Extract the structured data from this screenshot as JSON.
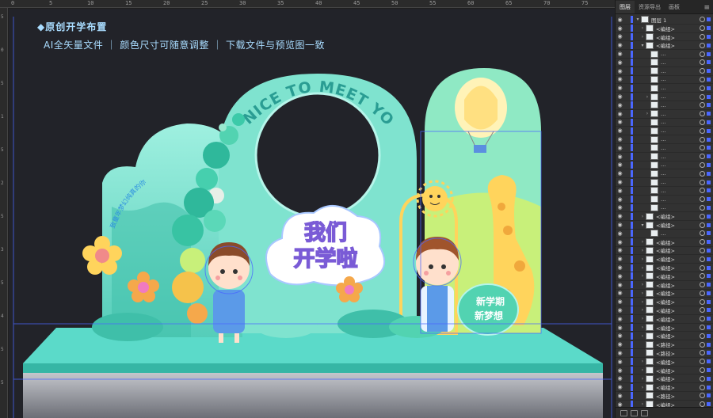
{
  "ruler": {
    "top_numbers": [
      "0",
      "5",
      "10",
      "15",
      "20",
      "25",
      "30",
      "35",
      "40",
      "45",
      "50",
      "55",
      "60",
      "65",
      "70",
      "75"
    ],
    "left_numbers": [
      "5",
      "0",
      "5",
      "1",
      "5",
      "2",
      "5",
      "3",
      "5",
      "4",
      "5",
      "5"
    ]
  },
  "canvas": {
    "heading_title": "◆原创开学布置",
    "heading_subtitle": "AI全矢量文件 ｜ 颜色尺寸可随意调整 ｜ 下载文件与预览图一致"
  },
  "artwork": {
    "arch_text": "NICE TO MEET YOU",
    "left_curve_text": "致童年梦幻纯真的你",
    "title_line1": "我们",
    "title_line2": "开学啦",
    "bubble_line1": "新学期",
    "bubble_line2": "新梦想",
    "colors": {
      "mint": "#7fe3cf",
      "teal": "#2fb3a2",
      "light_green": "#c8f07a",
      "yellow": "#ffd45c",
      "pink": "#f07ac0",
      "purple": "#7a5bd6",
      "blue_selection": "#4a67ff",
      "stage_top": "#59d9c8",
      "stage_front": "#9ea0a8"
    }
  },
  "panel": {
    "tabs": [
      "图层",
      "资源导出",
      "画板"
    ],
    "active_tab": "图层",
    "menu_icon": "hamburger-icon",
    "layers": [
      {
        "name": "图层 1",
        "indent": 0,
        "arrow": "▾"
      },
      {
        "name": "<编组>",
        "indent": 1,
        "arrow": "›"
      },
      {
        "name": "<编组>",
        "indent": 1,
        "arrow": "›"
      },
      {
        "name": "<编组>",
        "indent": 1,
        "arrow": "▾"
      },
      {
        "name": "…",
        "indent": 2,
        "arrow": ""
      },
      {
        "name": "…",
        "indent": 2,
        "arrow": ""
      },
      {
        "name": "…",
        "indent": 2,
        "arrow": ""
      },
      {
        "name": "…",
        "indent": 2,
        "arrow": ""
      },
      {
        "name": "…",
        "indent": 2,
        "arrow": ""
      },
      {
        "name": "…",
        "indent": 2,
        "arrow": "›"
      },
      {
        "name": "…",
        "indent": 2,
        "arrow": ""
      },
      {
        "name": "…",
        "indent": 2,
        "arrow": "›"
      },
      {
        "name": "…",
        "indent": 2,
        "arrow": ""
      },
      {
        "name": "…",
        "indent": 2,
        "arrow": ""
      },
      {
        "name": "…",
        "indent": 2,
        "arrow": ""
      },
      {
        "name": "…",
        "indent": 2,
        "arrow": ""
      },
      {
        "name": "…",
        "indent": 2,
        "arrow": ""
      },
      {
        "name": "…",
        "indent": 2,
        "arrow": ""
      },
      {
        "name": "…",
        "indent": 2,
        "arrow": ""
      },
      {
        "name": "…",
        "indent": 2,
        "arrow": ""
      },
      {
        "name": "…",
        "indent": 2,
        "arrow": ""
      },
      {
        "name": "…",
        "indent": 2,
        "arrow": ""
      },
      {
        "name": "…",
        "indent": 2,
        "arrow": ""
      },
      {
        "name": "<编组>",
        "indent": 1,
        "arrow": "›"
      },
      {
        "name": "<编组>",
        "indent": 1,
        "arrow": "▾"
      },
      {
        "name": "…",
        "indent": 2,
        "arrow": ""
      },
      {
        "name": "<编组>",
        "indent": 1,
        "arrow": "›"
      },
      {
        "name": "<编组>",
        "indent": 1,
        "arrow": "›"
      },
      {
        "name": "<编组>",
        "indent": 1,
        "arrow": "›"
      },
      {
        "name": "<编组>",
        "indent": 1,
        "arrow": "›"
      },
      {
        "name": "<编组>",
        "indent": 1,
        "arrow": "›"
      },
      {
        "name": "<编组>",
        "indent": 1,
        "arrow": "›"
      },
      {
        "name": "<编组>",
        "indent": 1,
        "arrow": "›"
      },
      {
        "name": "<编组>",
        "indent": 1,
        "arrow": "›"
      },
      {
        "name": "<编组>",
        "indent": 1,
        "arrow": "›"
      },
      {
        "name": "<编组>",
        "indent": 1,
        "arrow": "›"
      },
      {
        "name": "<编组>",
        "indent": 1,
        "arrow": "›"
      },
      {
        "name": "<编组>",
        "indent": 1,
        "arrow": "›"
      },
      {
        "name": "<路径>",
        "indent": 1,
        "arrow": ""
      },
      {
        "name": "<路径>",
        "indent": 1,
        "arrow": ""
      },
      {
        "name": "<编组>",
        "indent": 1,
        "arrow": "›"
      },
      {
        "name": "<编组>",
        "indent": 1,
        "arrow": "›"
      },
      {
        "name": "<编组>",
        "indent": 1,
        "arrow": "›"
      },
      {
        "name": "<编组>",
        "indent": 1,
        "arrow": "›"
      },
      {
        "name": "<路径>",
        "indent": 1,
        "arrow": ""
      },
      {
        "name": "<编组>",
        "indent": 1,
        "arrow": "›"
      },
      {
        "name": "<编组>",
        "indent": 1,
        "arrow": "›"
      }
    ]
  }
}
